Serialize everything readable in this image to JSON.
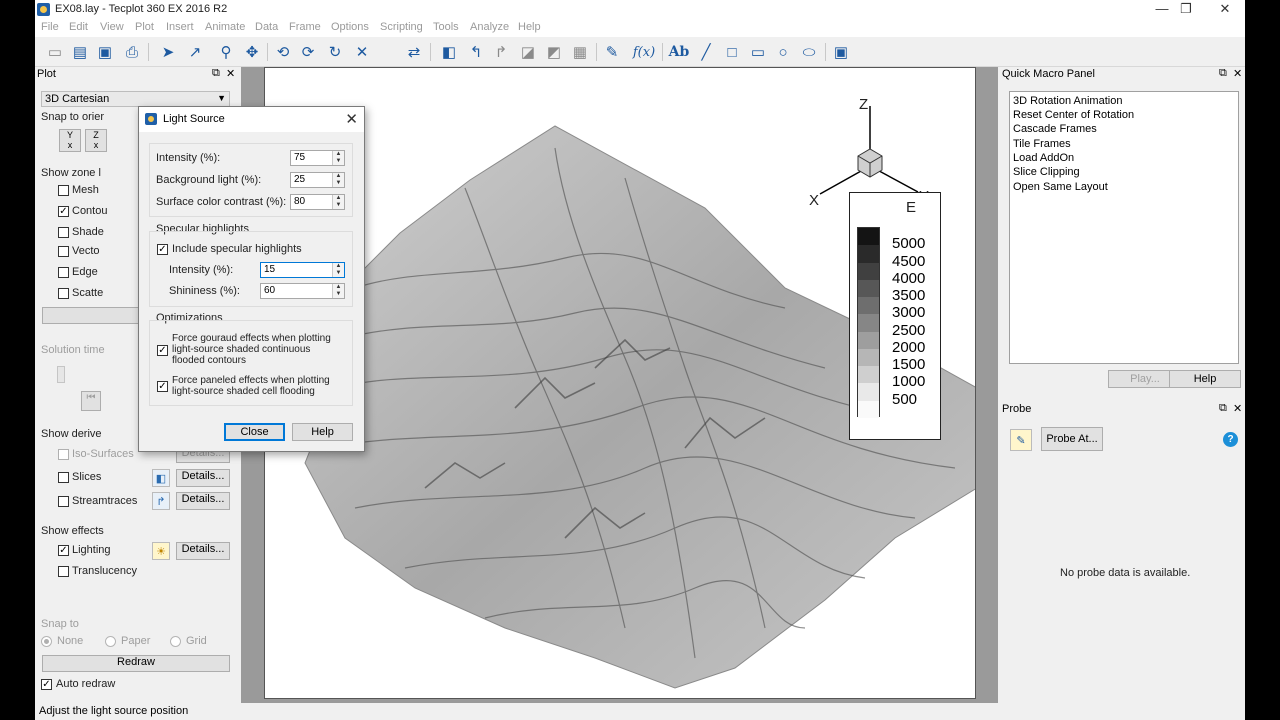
{
  "window": {
    "title": "EX08.lay - Tecplot 360 EX 2016 R2",
    "controls": [
      "—",
      "❐",
      "✕"
    ]
  },
  "menu": [
    "File",
    "Edit",
    "View",
    "Plot",
    "Insert",
    "Animate",
    "Data",
    "Frame",
    "Options",
    "Scripting",
    "Tools",
    "Analyze",
    "Help"
  ],
  "toolbar": {
    "icons": [
      "new-icon",
      "open-icon",
      "save-icon",
      "print-icon",
      "select-icon",
      "adjustor-icon",
      "zoom-icon",
      "translate-icon",
      "rotate-x-icon",
      "rotate-y-icon",
      "rotate-spherical-icon",
      "rotate-roller-icon",
      "rotate-twist-icon",
      "probe-icon",
      "slice-icon",
      "streamtrace-icon",
      "contour-line-icon",
      "iso-surface-icon",
      "frame-number-icon",
      "quick-edit-icon",
      "equation-icon",
      "text-icon",
      "line-icon",
      "square-icon",
      "rectangle-icon",
      "circle-icon",
      "ellipse-icon",
      "frame-icon"
    ]
  },
  "left_panel": {
    "title": "Plot",
    "plot_type": "3D Cartesian",
    "snap_label": "Snap to orier",
    "show_zone_label": "Show zone l",
    "zone_layers": [
      {
        "label": "Mesh",
        "checked": false
      },
      {
        "label": "Contou",
        "checked": true
      },
      {
        "label": "Shade",
        "checked": false
      },
      {
        "label": "Vecto",
        "checked": false
      },
      {
        "label": "Edge",
        "checked": false
      },
      {
        "label": "Scatte",
        "checked": false
      }
    ],
    "solution_time_label": "Solution time",
    "show_derived_label": "Show derive",
    "derived": [
      {
        "label": "Iso-Surfaces",
        "checked": false,
        "disabled": true,
        "details": "Details..."
      },
      {
        "label": "Slices",
        "checked": false,
        "disabled": false,
        "details": "Details..."
      },
      {
        "label": "Streamtraces",
        "checked": false,
        "disabled": false,
        "details": "Details..."
      }
    ],
    "show_effects_label": "Show effects",
    "effects": [
      {
        "label": "Lighting",
        "checked": true,
        "details": "Details..."
      },
      {
        "label": "Translucency",
        "checked": false
      }
    ],
    "snap_to_label": "Snap to",
    "snap_options": [
      "None",
      "Paper",
      "Grid"
    ],
    "snap_selected": "None",
    "redraw_label": "Redraw",
    "auto_redraw_label": "Auto redraw",
    "auto_redraw_checked": true
  },
  "light_source_dialog": {
    "title": "Light Source",
    "intensity_label": "Intensity (%):",
    "intensity": "75",
    "background_light_label": "Background light (%):",
    "background_light": "25",
    "surface_contrast_label": "Surface color contrast (%):",
    "surface_contrast": "80",
    "specular_group": "Specular highlights",
    "include_specular_label": "Include specular highlights",
    "include_specular_checked": true,
    "spec_intensity_label": "Intensity (%):",
    "spec_intensity": "15",
    "shininess_label": "Shininess (%):",
    "shininess": "60",
    "optimizations_group": "Optimizations",
    "force_gouraud": [
      "Force gouraud effects when plotting",
      "light-source shaded continuous",
      "flooded contours"
    ],
    "force_gouraud_checked": true,
    "force_paneled": [
      "Force paneled effects when plotting",
      "light-source shaded cell flooding"
    ],
    "force_paneled_checked": true,
    "close_label": "Close",
    "help_label": "Help"
  },
  "plot": {
    "axes": {
      "x": "X",
      "y": "Y",
      "z": "Z"
    },
    "legend_title": "E",
    "legend_levels": [
      "5000",
      "4500",
      "4000",
      "3500",
      "3000",
      "2500",
      "2000",
      "1500",
      "1000",
      "500"
    ],
    "legend_colors": [
      "#141414",
      "#2a2a2a",
      "#404040",
      "#575757",
      "#6e6e6e",
      "#868686",
      "#9e9e9e",
      "#b6b6b6",
      "#cfcfcf",
      "#e9e9e9",
      "#fafafa"
    ]
  },
  "quick_macro_panel": {
    "title": "Quick Macro Panel",
    "items": [
      "3D Rotation Animation",
      "Reset Center of Rotation",
      "Cascade Frames",
      "Tile Frames",
      "Load AddOn",
      "Slice Clipping",
      "Open Same Layout"
    ],
    "play_label": "Play...",
    "help_label": "Help"
  },
  "probe_panel": {
    "title": "Probe",
    "probe_at_label": "Probe At...",
    "help_icon": "?",
    "empty_message": "No probe data is available."
  },
  "status_bar": {
    "text": "Adjust the light source position"
  }
}
